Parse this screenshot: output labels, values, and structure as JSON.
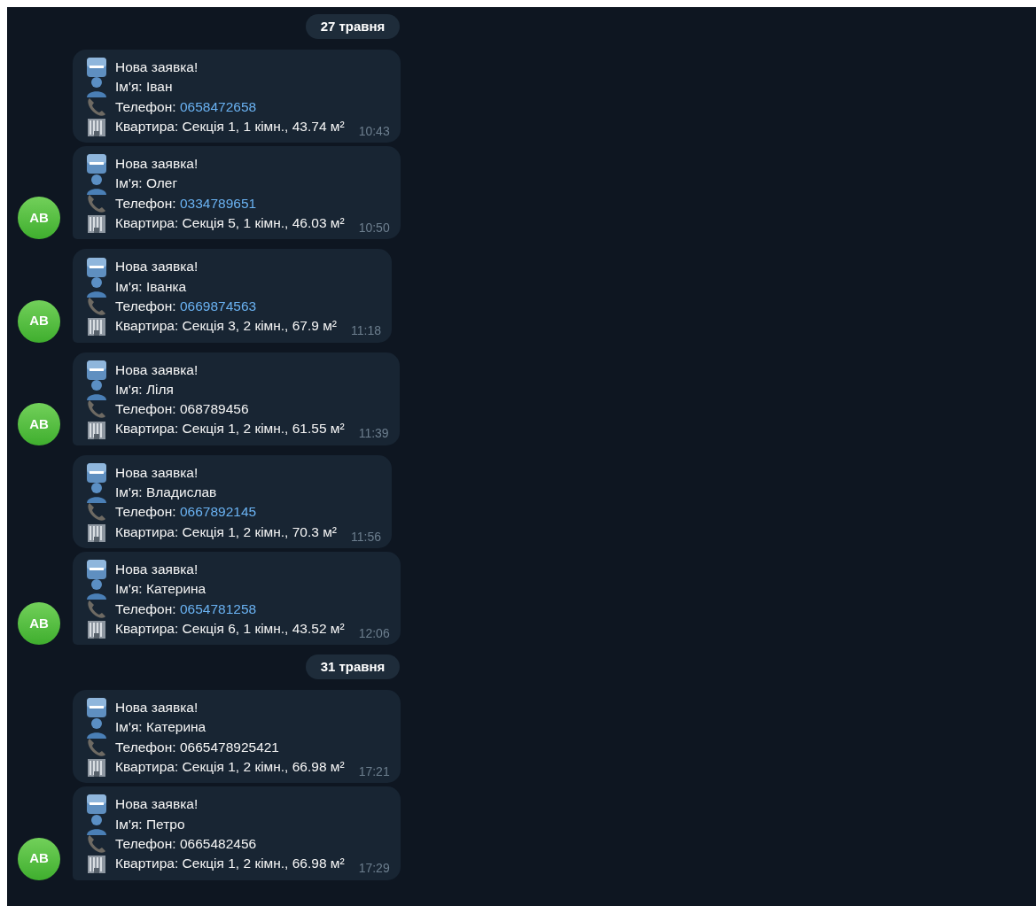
{
  "days": [
    {
      "date": "27 травня",
      "groups": [
        {
          "avatar": "AB",
          "messages": [
            {
              "title": "Нова заявка!",
              "name": "Ім'я: Іван",
              "phone_label": "Телефон:",
              "phone": "0658472658",
              "phone_link": true,
              "apartment": "Квартира: Секція 1, 1 кімн., 43.74 м²",
              "time": "10:43"
            },
            {
              "title": "Нова заявка!",
              "name": "Ім'я: Олег",
              "phone_label": "Телефон:",
              "phone": "0334789651",
              "phone_link": true,
              "apartment": "Квартира: Секція 5, 1 кімн., 46.03 м²",
              "time": "10:50"
            }
          ]
        },
        {
          "avatar": "AB",
          "messages": [
            {
              "title": "Нова заявка!",
              "name": "Ім'я: Іванка",
              "phone_label": "Телефон:",
              "phone": "0669874563",
              "phone_link": true,
              "apartment": "Квартира: Секція 3, 2 кімн., 67.9 м²",
              "time": "11:18"
            }
          ]
        },
        {
          "avatar": "AB",
          "messages": [
            {
              "title": "Нова заявка!",
              "name": "Ім'я: Ліля",
              "phone_label": "Телефон:",
              "phone": "068789456",
              "phone_link": false,
              "apartment": "Квартира: Секція 1, 2 кімн., 61.55 м²",
              "time": "11:39"
            }
          ]
        },
        {
          "avatar": "AB",
          "messages": [
            {
              "title": "Нова заявка!",
              "name": "Ім'я: Владислав",
              "phone_label": "Телефон:",
              "phone": "0667892145",
              "phone_link": true,
              "apartment": "Квартира: Секція 1, 2 кімн., 70.3 м²",
              "time": "11:56"
            },
            {
              "title": "Нова заявка!",
              "name": "Ім'я: Катерина",
              "phone_label": "Телефон:",
              "phone": "0654781258",
              "phone_link": true,
              "apartment": "Квартира: Секція 6, 1 кімн., 43.52 м²",
              "time": "12:06"
            }
          ]
        }
      ]
    },
    {
      "date": "31 травня",
      "groups": [
        {
          "avatar": "AB",
          "messages": [
            {
              "title": "Нова заявка!",
              "name": "Ім'я: Катерина",
              "phone_label": "Телефон:",
              "phone": "0665478925421",
              "phone_link": false,
              "apartment": "Квартира: Секція 1, 2 кімн., 66.98 м²",
              "time": "17:21"
            },
            {
              "title": "Нова заявка!",
              "name": "Ім'я: Петро",
              "phone_label": "Телефон:",
              "phone": "0665482456",
              "phone_link": false,
              "apartment": "Квартира: Секція 1, 2 кімн., 66.98 м²",
              "time": "17:29"
            }
          ]
        }
      ]
    }
  ]
}
